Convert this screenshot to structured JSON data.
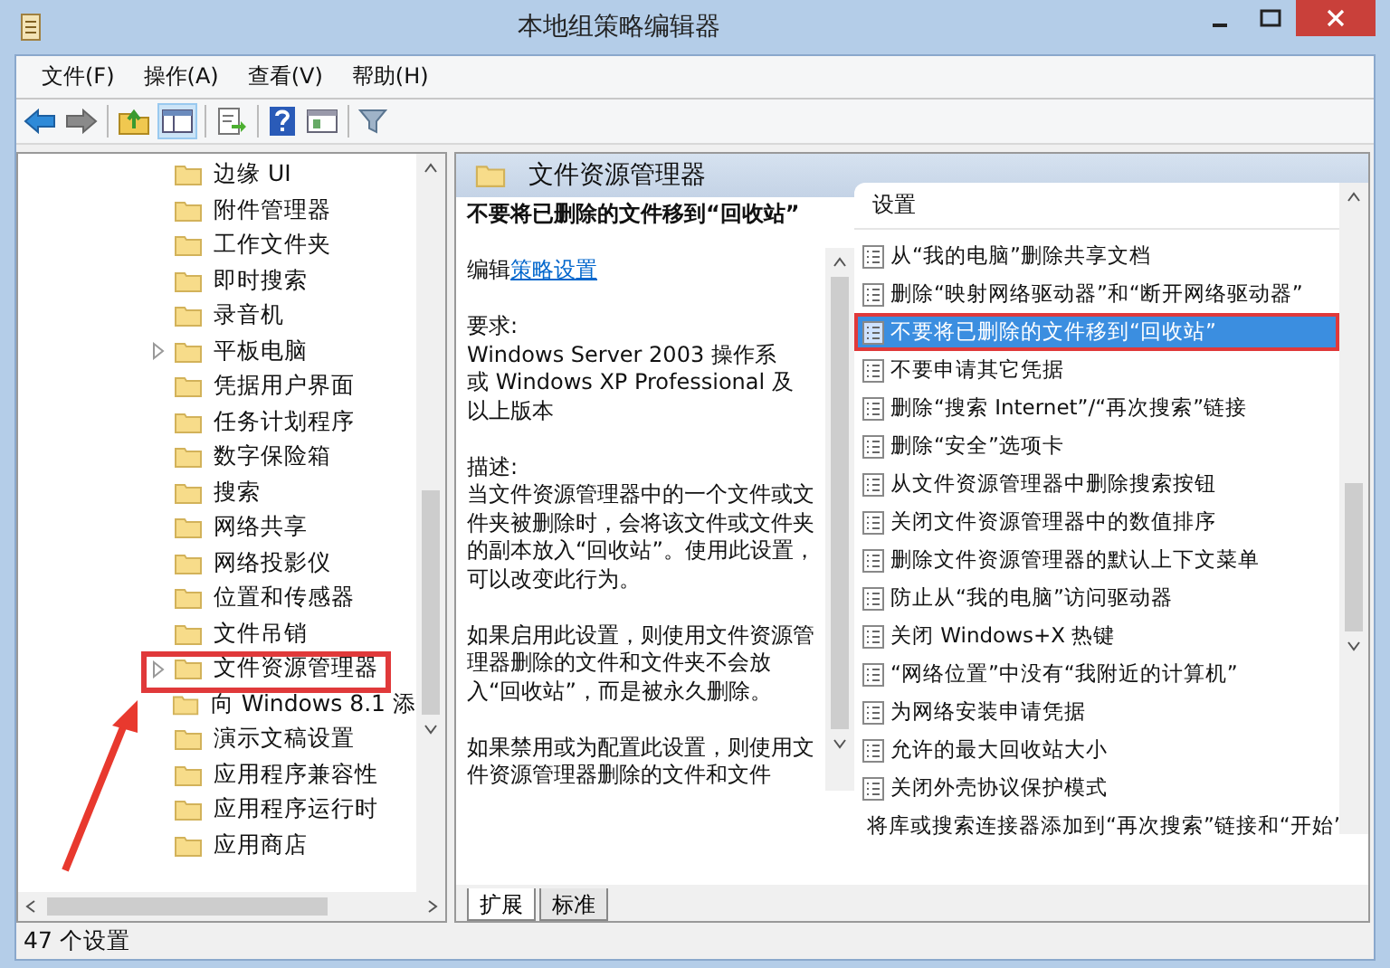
{
  "window": {
    "title": "本地组策略编辑器"
  },
  "menu": [
    "文件(F)",
    "操作(A)",
    "查看(V)",
    "帮助(H)"
  ],
  "tree": {
    "items": [
      {
        "label": "边缘 UI",
        "expandable": false
      },
      {
        "label": "附件管理器",
        "expandable": false
      },
      {
        "label": "工作文件夹",
        "expandable": false
      },
      {
        "label": "即时搜索",
        "expandable": false
      },
      {
        "label": "录音机",
        "expandable": false
      },
      {
        "label": "平板电脑",
        "expandable": true
      },
      {
        "label": "凭据用户界面",
        "expandable": false
      },
      {
        "label": "任务计划程序",
        "expandable": false
      },
      {
        "label": "数字保险箱",
        "expandable": false
      },
      {
        "label": "搜索",
        "expandable": false
      },
      {
        "label": "网络共享",
        "expandable": false
      },
      {
        "label": "网络投影仪",
        "expandable": false
      },
      {
        "label": "位置和传感器",
        "expandable": false
      },
      {
        "label": "文件吊销",
        "expandable": false
      },
      {
        "label": "文件资源管理器",
        "expandable": true
      },
      {
        "label": "向 Windows 8.1 添",
        "expandable": false
      },
      {
        "label": "演示文稿设置",
        "expandable": false
      },
      {
        "label": "应用程序兼容性",
        "expandable": false
      },
      {
        "label": "应用程序运行时",
        "expandable": false
      },
      {
        "label": "应用商店",
        "expandable": false
      }
    ]
  },
  "details": {
    "header": "文件资源管理器",
    "description": {
      "title": "不要将已删除的文件移到“回收站”",
      "edit_prefix": "编辑",
      "edit_link": "策略设置",
      "paragraphs": [
        [
          "要求:",
          "Windows Server 2003 操作系",
          "或 Windows XP Professional 及",
          "以上版本"
        ],
        [
          "描述:",
          "当文件资源管理器中的一个文件或文件夹被删除时，会将该文件或文件夹的副本放入“回收站”。使用此设置，可以改变此行为。"
        ],
        [
          "如果启用此设置，则使用文件资源管理器删除的文件和文件夹不会放入“回收站”，而是被永久删除。"
        ],
        [
          "如果禁用或为配置此设置，则使用文件资源管理器删除的文件和文件"
        ]
      ]
    },
    "settings": {
      "header": "设置",
      "items": [
        {
          "label": "从“我的电脑”删除共享文档",
          "selected": false
        },
        {
          "label": "删除“映射网络驱动器”和“断开网络驱动器”",
          "selected": false
        },
        {
          "label": "不要将已删除的文件移到“回收站”",
          "selected": true
        },
        {
          "label": "不要申请其它凭据",
          "selected": false
        },
        {
          "label": "删除“搜索 Internet”/“再次搜索”链接",
          "selected": false
        },
        {
          "label": "删除“安全”选项卡",
          "selected": false
        },
        {
          "label": "从文件资源管理器中删除搜索按钮",
          "selected": false
        },
        {
          "label": "关闭文件资源管理器中的数值排序",
          "selected": false
        },
        {
          "label": "删除文件资源管理器的默认上下文菜单",
          "selected": false
        },
        {
          "label": "防止从“我的电脑”访问驱动器",
          "selected": false
        },
        {
          "label": "关闭 Windows+X 热键",
          "selected": false
        },
        {
          "label": "“网络位置”中没有“我附近的计算机”",
          "selected": false
        },
        {
          "label": "为网络安装申请凭据",
          "selected": false
        },
        {
          "label": "允许的最大回收站大小",
          "selected": false
        },
        {
          "label": "关闭外壳协议保护模式",
          "selected": false
        },
        {
          "label": "将库或搜索连接器添加到“再次搜索”链接和“开始”",
          "selected": false
        }
      ]
    },
    "tabs": [
      {
        "label": "扩展",
        "selected": true
      },
      {
        "label": "标准",
        "selected": false
      }
    ]
  },
  "status_bar": "47 个设置"
}
